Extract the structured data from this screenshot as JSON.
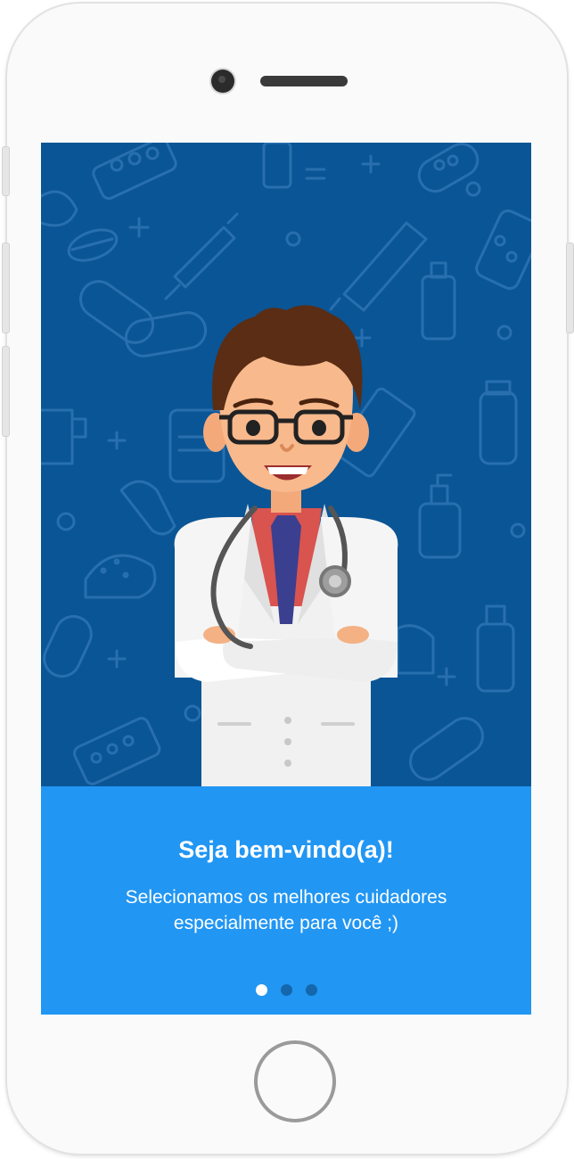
{
  "onboarding": {
    "title": "Seja bem-vindo(a)!",
    "subtitle_line1": "Selecionamos os melhores cuidadores",
    "subtitle_line2": "especialmente para você ;)",
    "pagination": {
      "total": 3,
      "active": 1
    }
  },
  "colors": {
    "hero_background": "#0a5595",
    "panel_background": "#2196f3",
    "dot_active": "#ffffff",
    "dot_inactive": "#1467ab"
  },
  "illustration": "doctor-with-stethoscope"
}
